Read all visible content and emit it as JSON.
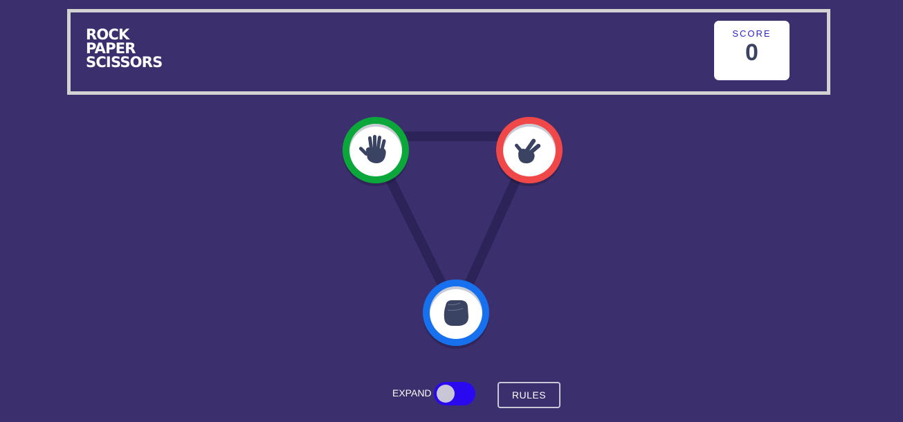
{
  "header": {
    "title_lines": [
      "ROCK",
      "PAPER",
      "SCISSORS"
    ],
    "score_label": "SCORE",
    "score_value": "0"
  },
  "tokens": [
    {
      "name": "paper",
      "icon": "paper-hand-icon",
      "ring_color": "#0ca73a"
    },
    {
      "name": "scissors",
      "icon": "scissors-hand-icon",
      "ring_color": "#f04848"
    },
    {
      "name": "rock",
      "icon": "rock-fist-icon",
      "ring_color": "#1771ef"
    }
  ],
  "footer": {
    "expand_label": "EXPAND",
    "expand_on": true,
    "rules_label": "RULES"
  },
  "colors": {
    "background": "#3b2f6e",
    "toggle_track": "#2a09f0",
    "score_label": "#2a24c9",
    "score_value": "#3b4363",
    "icon_fill": "#3b4363"
  }
}
